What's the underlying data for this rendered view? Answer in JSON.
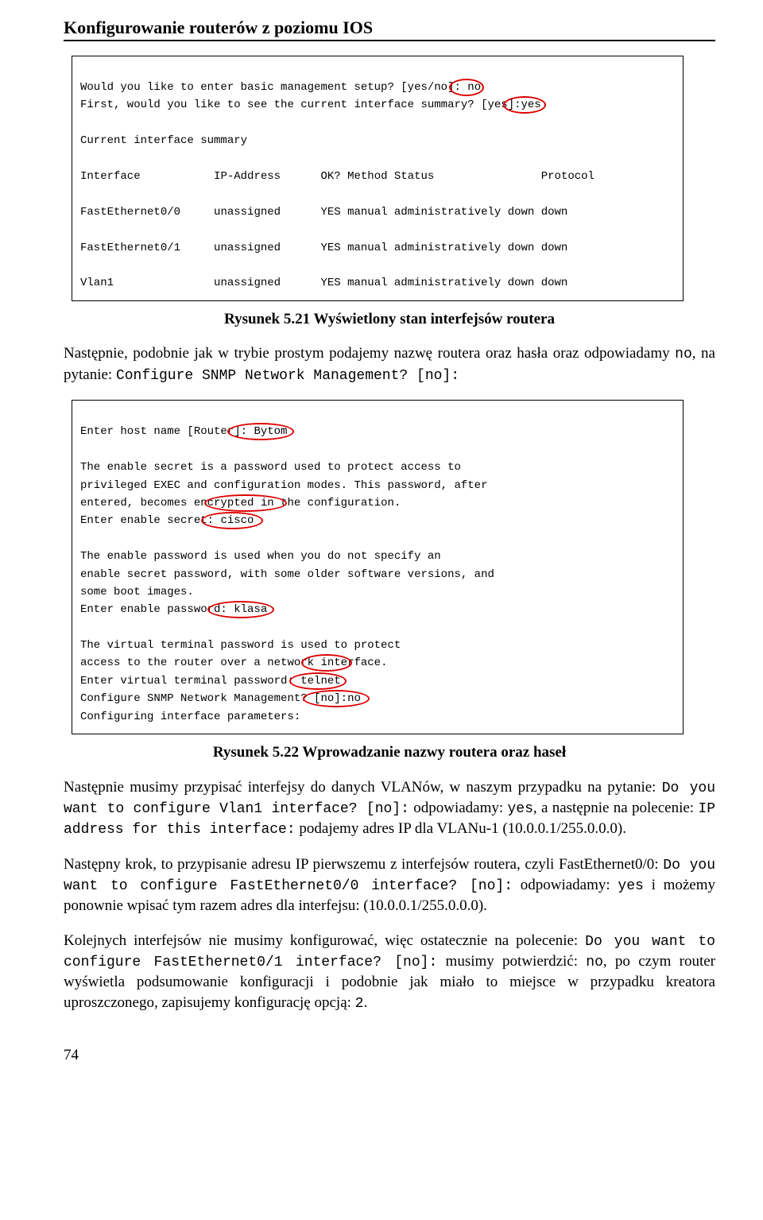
{
  "header": {
    "title": "Konfigurowanie routerów z poziomu IOS"
  },
  "fig1": {
    "line1a": "Would you like to enter basic management setup? [yes/no]",
    "line1b": ": no",
    "line2a": "First, would you like to see the current interface summary? [yes",
    "line2b": "]:yes",
    "line4": "Current interface summary",
    "hdr_iface": "Interface",
    "hdr_ip": "IP-Address",
    "hdr_ok": "OK? Method Status",
    "hdr_proto": "Protocol",
    "r1_iface": "FastEthernet0/0",
    "r1_ip": "unassigned",
    "r1_status": "YES manual administratively down down",
    "r2_iface": "FastEthernet0/1",
    "r2_ip": "unassigned",
    "r2_status": "YES manual administratively down down",
    "r3_iface": "Vlan1",
    "r3_ip": "unassigned",
    "r3_status": "YES manual administratively down down"
  },
  "caption1": "Rysunek 5.21 Wyświetlony stan interfejsów routera",
  "para1": {
    "t1": "Następnie, podobnie jak w trybie prostym podajemy nazwę routera oraz hasła oraz odpowiadamy ",
    "t2": "no",
    "t3": ", na pytanie: ",
    "t4": "Configure SNMP Network Management? [no]:"
  },
  "fig2": {
    "l1a": "Enter host name [Router",
    "l1b": "]: Bytom",
    "blk1_1": "The enable secret is a password used to protect access to",
    "blk1_2": "privileged EXEC and configuration modes. This password, after",
    "blk1_3a": "entered, becomes enc",
    "blk1_3b": "rypted in",
    "blk1_3c": " the configuration.",
    "l2a": "Enter enable secret",
    "l2b": ": cisco",
    "blk2_1": "The enable password is used when you do not specify an",
    "blk2_2": "enable secret password, with some older software versions, and",
    "blk2_3": "some boot images.",
    "l3a": "Enter enable passwor",
    "l3b": "d: klasa",
    "blk3_1": "The virtual terminal password is used to protect",
    "blk3_2a": "access to the router over a networ",
    "blk3_2b": "k in",
    "blk3_2c": "terface.",
    "l4a": "Enter virtual terminal password:",
    "l4b": " telnet",
    "l5a": "Configure SNMP Network Management?",
    "l5b": " [no]:no",
    "l6": "Configuring interface parameters:"
  },
  "caption2": "Rysunek 5.22 Wprowadzanie nazwy routera oraz haseł",
  "para2": {
    "t1": "Następnie musimy przypisać interfejsy do danych VLANów, w naszym przypadku na pytanie: ",
    "c1": "Do you want to configure Vlan1 interface? [no]:",
    "t2": " odpowiadamy: ",
    "c2": "yes",
    "t3": ", a następnie na polecenie: ",
    "c3": "IP address for this interface:",
    "t4": " podajemy adres IP dla VLANu-1 (10.0.0.1/255.0.0.0)."
  },
  "para3": {
    "t1": "Następny krok, to przypisanie adresu IP pierwszemu z interfejsów routera, czyli FastEthernet0/0: ",
    "c1": "Do you want to configure FastEthernet0/0 interface? [no]:",
    "t2": " odpowiadamy: ",
    "c2": "yes",
    "t3": " i możemy ponownie wpisać tym razem adres dla interfejsu: (10.0.0.1/255.0.0.0)."
  },
  "para4": {
    "t1": "Kolejnych interfejsów nie musimy konfigurować, więc ostatecznie na polecenie: ",
    "c1": "Do you want to configure FastEthernet0/1 interface? [no]:",
    "t2": " musimy potwierdzić: ",
    "c2": "no",
    "t3": ", po czym router wyświetla podsumowanie konfiguracji i podobnie jak miało to miejsce w przypadku kreatora uproszczonego, zapisujemy konfigurację opcją: ",
    "c3": "2",
    "t4": "."
  },
  "page": "74"
}
